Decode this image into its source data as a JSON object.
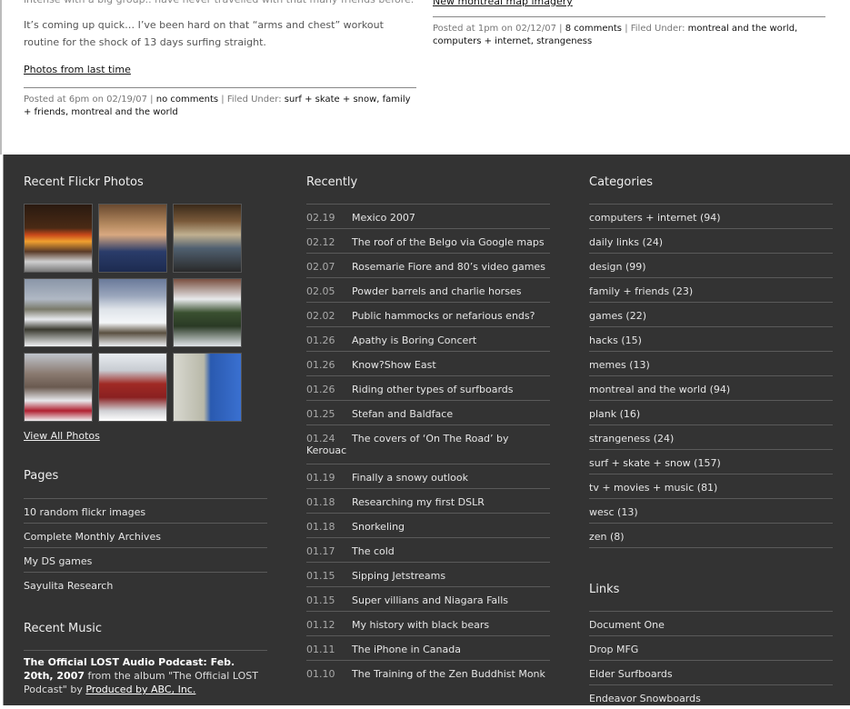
{
  "post_left": {
    "cutoff_line": "intense with a big group.. have never travelled with that many friends before.",
    "paragraph": "It’s coming up quick… I’ve been hard on that “arms and chest” workout routine for the shock of 13 days surfing straight.",
    "link": "Photos from last time",
    "meta_prefix": "Posted at 6pm on 02/19/07 |",
    "comments": "no comments",
    "filed": "| Filed Under:",
    "categories": "surf + skate + snow, family + friends, montreal and the world"
  },
  "post_right": {
    "cutoff_link": "New montreal map imagery",
    "meta_prefix": "Posted at 1pm on 02/12/07 |",
    "comments": "8 comments",
    "filed": "| Filed Under:",
    "categories": "montreal and the world, computers + internet, strangeness"
  },
  "flickr": {
    "title": "Recent Flickr Photos",
    "view_all": "View All Photos",
    "photos": [
      "fireplace",
      "person at table",
      "cafeteria interior",
      "snowy picnic tables",
      "snowy ski slope",
      "snow covered car",
      "snowy street",
      "red brick house",
      "blue house"
    ]
  },
  "pages": {
    "title": "Pages",
    "items": [
      "10 random flickr images",
      "Complete Monthly Archives",
      "My DS games",
      "Sayulita Research"
    ]
  },
  "music": {
    "title": "Recent Music",
    "track": "The Official LOST Audio Podcast: Feb. 20th, 2007",
    "from_text": "from the album \"The Official LOST Podcast\" by",
    "artist": "Produced by ABC, Inc."
  },
  "recently": {
    "title": "Recently",
    "items": [
      {
        "date": "02.19",
        "title": "Mexico 2007"
      },
      {
        "date": "02.12",
        "title": "The roof of the Belgo via Google maps"
      },
      {
        "date": "02.07",
        "title": "Rosemarie Fiore and 80’s video games"
      },
      {
        "date": "02.05",
        "title": "Powder barrels and charlie horses"
      },
      {
        "date": "02.02",
        "title": "Public hammocks or nefarious ends?"
      },
      {
        "date": "01.26",
        "title": "Apathy is Boring Concert"
      },
      {
        "date": "01.26",
        "title": "Know?Show East"
      },
      {
        "date": "01.26",
        "title": "Riding other types of surfboards"
      },
      {
        "date": "01.25",
        "title": "Stefan and Baldface"
      },
      {
        "date": "01.24",
        "title": "The covers of ‘On The Road’ by Kerouac"
      },
      {
        "date": "01.19",
        "title": "Finally a snowy outlook"
      },
      {
        "date": "01.18",
        "title": "Researching my first DSLR"
      },
      {
        "date": "01.18",
        "title": "Snorkeling"
      },
      {
        "date": "01.17",
        "title": "The cold"
      },
      {
        "date": "01.15",
        "title": "Sipping Jetstreams"
      },
      {
        "date": "01.15",
        "title": "Super villians and Niagara Falls"
      },
      {
        "date": "01.12",
        "title": "My history with black bears"
      },
      {
        "date": "01.11",
        "title": "The iPhone in Canada"
      },
      {
        "date": "01.10",
        "title": "The Training of the Zen Buddhist Monk"
      }
    ]
  },
  "categories": {
    "title": "Categories",
    "items": [
      "computers + internet (94)",
      "daily links (24)",
      "design (99)",
      "family + friends (23)",
      "games (22)",
      "hacks (15)",
      "memes (13)",
      "montreal and the world (94)",
      "plank (16)",
      "strangeness (24)",
      "surf + skate + snow (157)",
      "tv + movies + music (81)",
      "wesc (13)",
      "zen (8)"
    ]
  },
  "links": {
    "title": "Links",
    "items": [
      "Document One",
      "Drop MFG",
      "Elder Surfboards",
      "Endeavor Snowboards"
    ]
  }
}
